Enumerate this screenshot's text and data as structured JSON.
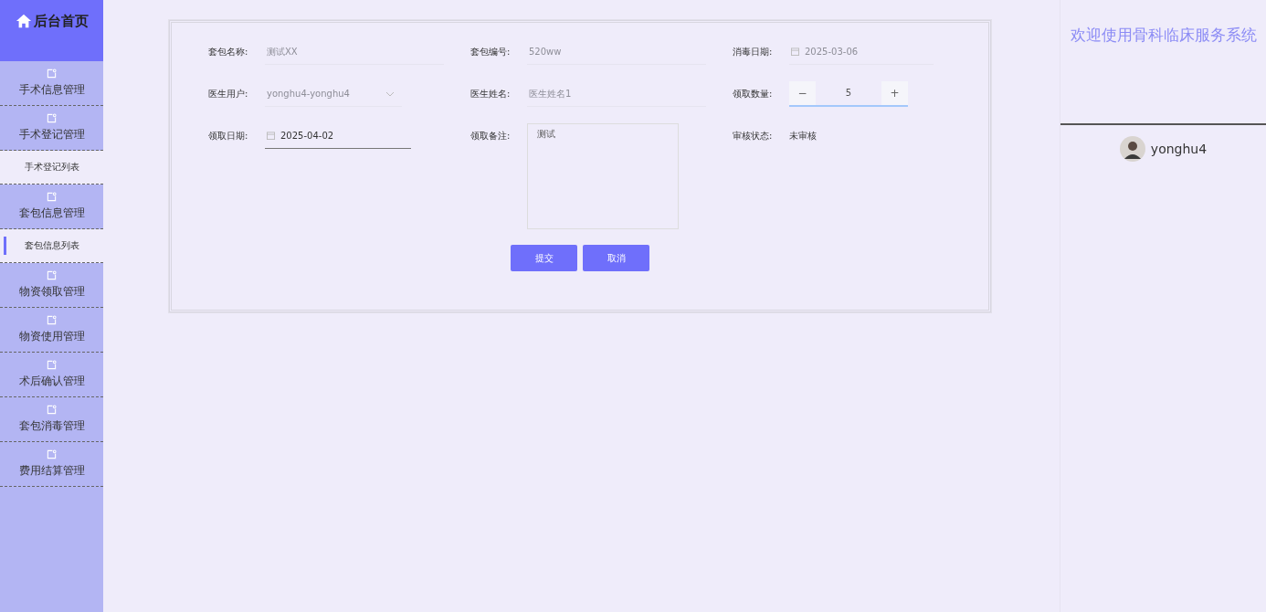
{
  "sidebar": {
    "home": "后台首页",
    "items": [
      {
        "label": "手术信息管理"
      },
      {
        "label": "手术登记管理",
        "children": [
          {
            "label": "手术登记列表",
            "selected": false
          }
        ]
      },
      {
        "label": "套包信息管理",
        "children": [
          {
            "label": "套包信息列表",
            "selected": true
          }
        ]
      },
      {
        "label": "物资领取管理"
      },
      {
        "label": "物资使用管理"
      },
      {
        "label": "术后确认管理"
      },
      {
        "label": "套包消毒管理"
      },
      {
        "label": "费用结算管理"
      }
    ]
  },
  "form": {
    "fields": [
      {
        "label": "套包名称:",
        "kind": "text",
        "value": "测试XX",
        "disabled": true
      },
      {
        "label": "套包编号:",
        "kind": "text",
        "value": "520ww",
        "disabled": true
      },
      {
        "label": "消毒日期:",
        "kind": "date",
        "value": "2025-03-06",
        "disabled": true
      },
      {
        "label": "医生用户:",
        "kind": "select",
        "value": "yonghu4-yonghu4",
        "disabled": true
      },
      {
        "label": "医生姓名:",
        "kind": "text",
        "value": "医生姓名1",
        "disabled": true
      },
      {
        "label": "领取数量:",
        "kind": "number",
        "value": "5",
        "minus": "−",
        "plus": "+",
        "disabled": false
      },
      {
        "label": "领取日期:",
        "kind": "date",
        "value": "2025-04-02",
        "disabled": false
      },
      {
        "label": "领取备注:",
        "kind": "textarea",
        "value": "测试",
        "disabled": false
      },
      {
        "label": "审核状态:",
        "kind": "static",
        "value": "未审核",
        "disabled": false
      }
    ],
    "buttons": [
      "提交",
      "取消"
    ]
  },
  "right_panel": {
    "title": "欢迎使用骨科临床服务系统",
    "username": "yonghu4"
  }
}
